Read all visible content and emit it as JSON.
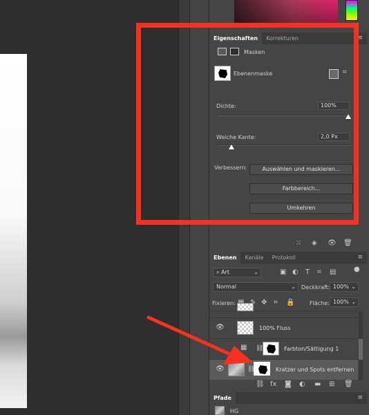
{
  "properties_panel": {
    "tabs": [
      "Eigenschaften",
      "Korrekturen"
    ],
    "masks_label": "Masken",
    "mask_type_label": "Ebenenmaske",
    "density_label": "Dichte:",
    "density_value": "100%",
    "density_level": 1.0,
    "feather_label": "Weiche Kante:",
    "feather_value": "2,0 Px",
    "feather_level": 0.1,
    "refine_label": "Verbessern:",
    "btn_select_mask": "Auswählen und maskieren...",
    "btn_color_range": "Farbbereich...",
    "btn_invert": "Umkehren"
  },
  "layers_panel": {
    "tabs": [
      "Ebenen",
      "Kanäle",
      "Protokoll"
    ],
    "filter_kind": "Art",
    "blend_mode": "Normal",
    "opacity_label": "Deckkraft:",
    "opacity_value": "100%",
    "lock_label": "Fixieren:",
    "fill_label": "Fläche:",
    "fill_value": "100%",
    "layers": [
      {
        "name": "100% Fluss",
        "visible": true
      },
      {
        "name": "Farbton/Sättigung 1",
        "visible": false
      },
      {
        "name": "Kratzer und Spots entfernen",
        "visible": true,
        "selected": true
      }
    ]
  },
  "paths_panel": {
    "tab": "Pfade",
    "item": "HG"
  },
  "colors": {
    "annotation_red": "#f53222",
    "panel_bg": "#454545"
  }
}
